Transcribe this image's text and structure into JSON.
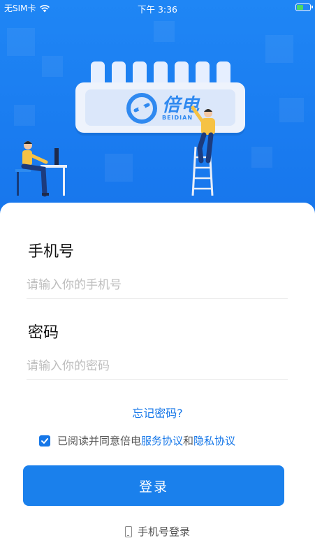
{
  "status_bar": {
    "carrier": "无SIM卡",
    "time": "下午 3:36",
    "battery_level": 0.55
  },
  "brand": {
    "name": "倍电",
    "subtitle": "BEIDIAN",
    "color": "#2f89f0"
  },
  "form": {
    "phone_label": "手机号",
    "phone_placeholder": "请输入你的手机号",
    "phone_value": "",
    "password_label": "密码",
    "password_placeholder": "请输入你的密码",
    "password_value": ""
  },
  "forgot_password": "忘记密码?",
  "agreement": {
    "checked": true,
    "prefix": "已阅读并同意倍电",
    "service_link": "服务协议",
    "conjunction": "和",
    "privacy_link": "隐私协议"
  },
  "login_button": "登录",
  "phone_login": "手机号登录",
  "colors": {
    "hero_blue": "#1a7cf0",
    "accent": "#1677e8",
    "button": "#1a80ec"
  }
}
